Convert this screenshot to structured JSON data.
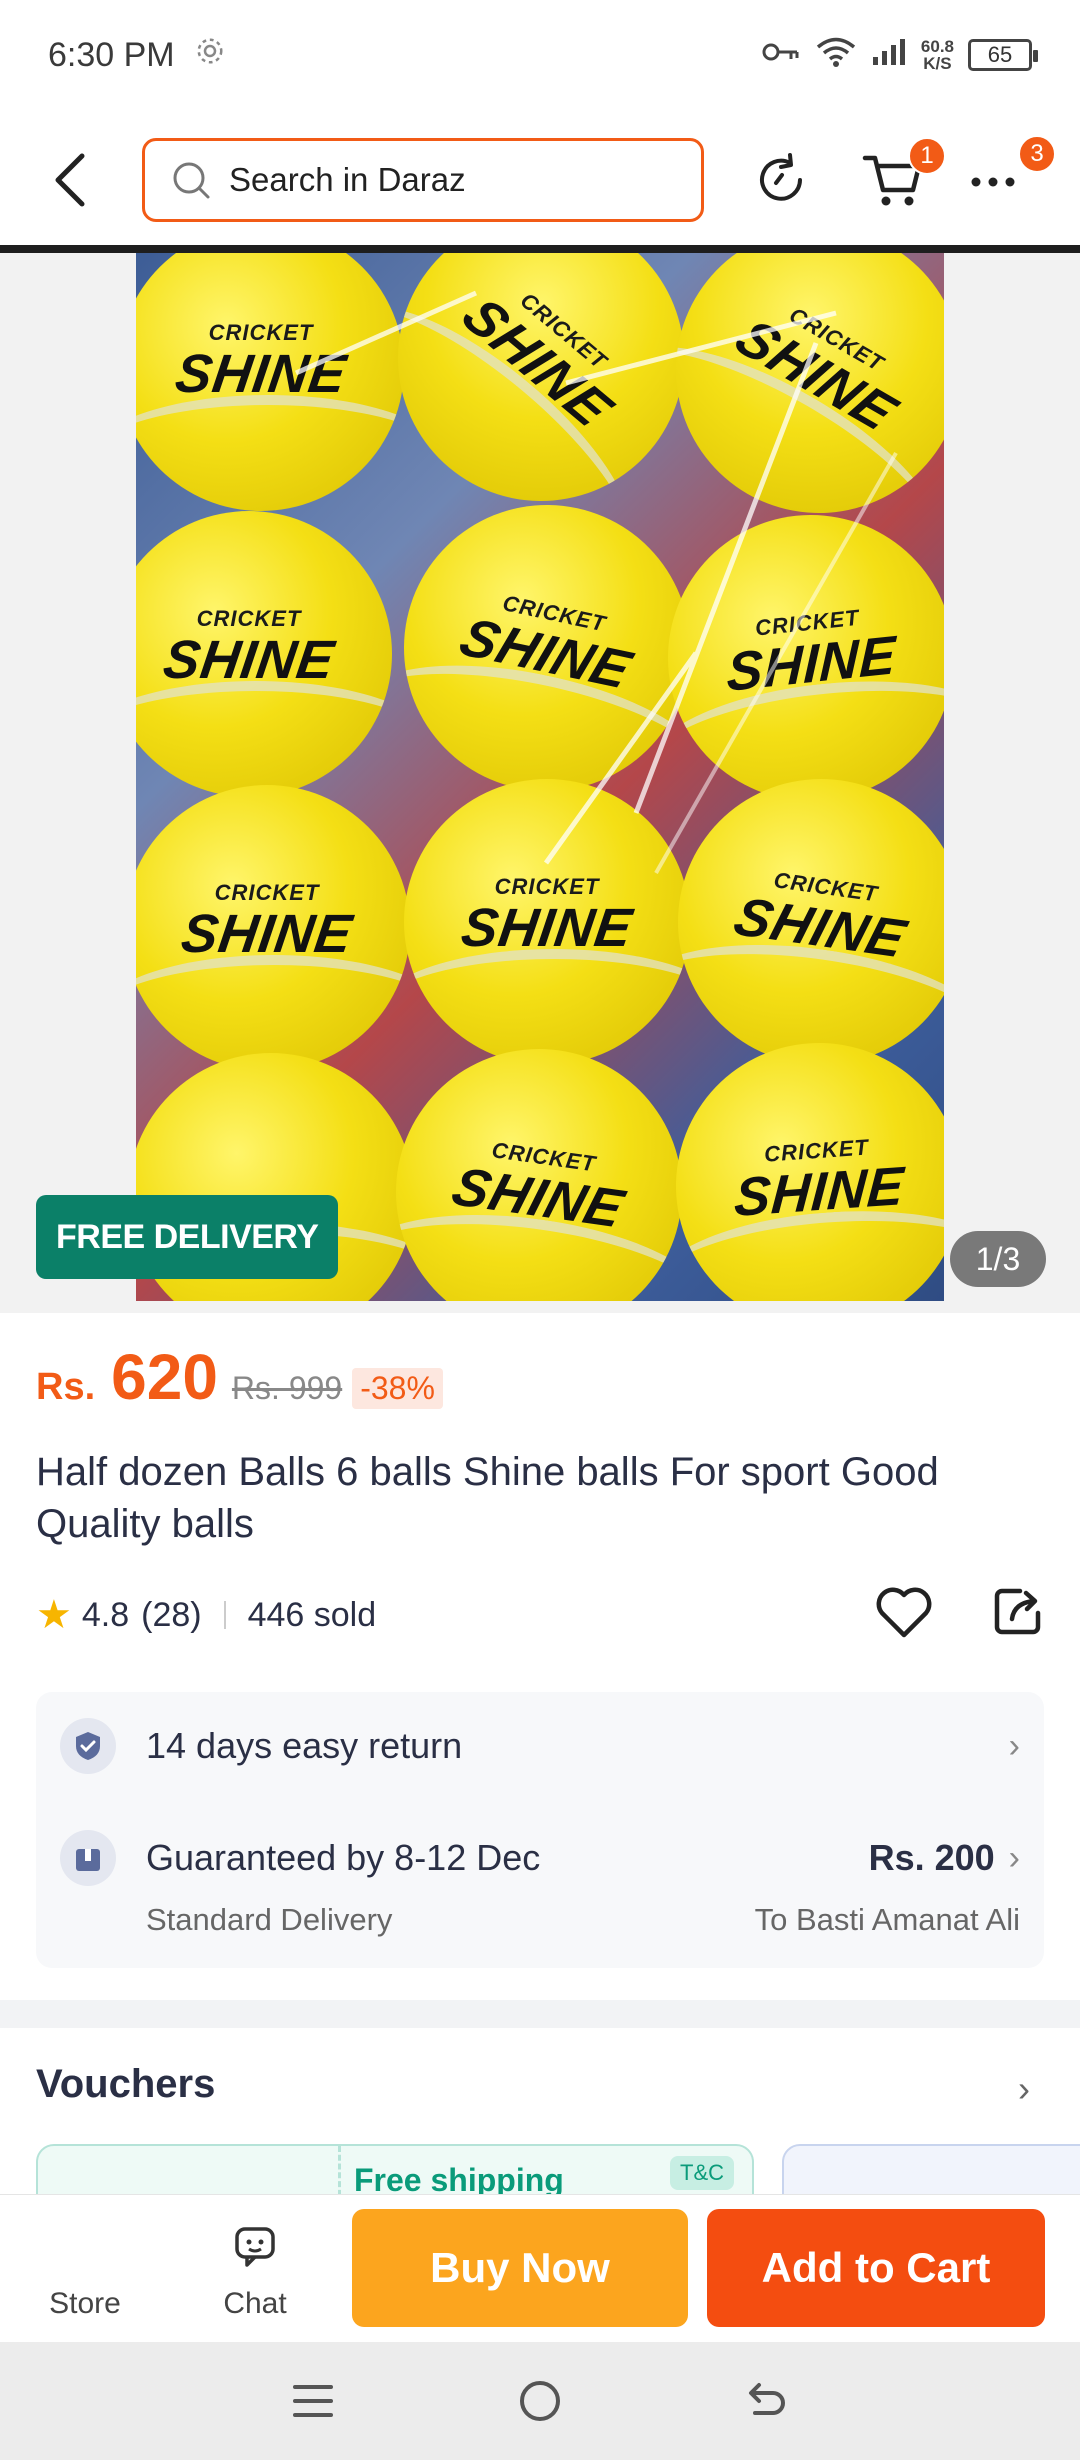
{
  "status_bar": {
    "time": "6:30 PM",
    "net_speed_value": "60.8",
    "net_speed_unit": "K/S",
    "battery": "65",
    "icons": [
      "settings-gear-icon",
      "key-icon",
      "wifi-icon",
      "signal-icon",
      "battery-icon"
    ]
  },
  "nav": {
    "search_placeholder": "Search in Daraz",
    "cart_badge": "1",
    "more_badge": "3",
    "icons": [
      "back-icon",
      "search-icon",
      "refresh-icon",
      "cart-icon",
      "more-icon"
    ]
  },
  "gallery": {
    "free_delivery_label": "FREE DELIVERY",
    "image_counter": "1/3",
    "ball_brand_small": "CRICKET",
    "ball_brand_big": "SHINE"
  },
  "product": {
    "currency": "Rs.",
    "price": "620",
    "original_price": "Rs. 999",
    "discount": "-38%",
    "title": "Half dozen Balls 6 balls Shine balls For sport Good Quality balls",
    "rating": "4.8",
    "rating_count": "(28)",
    "sold": "446 sold"
  },
  "info": {
    "return_text": "14 days easy return",
    "delivery_guarantee": "Guaranteed by 8-12 Dec",
    "delivery_type": "Standard Delivery",
    "delivery_fee": "Rs. 200",
    "delivery_to": "To Basti Amanat Ali"
  },
  "vouchers": {
    "title": "Vouchers",
    "card_title": "Free shipping",
    "card_tag": "T&C"
  },
  "action_bar": {
    "store_label": "Store",
    "chat_label": "Chat",
    "buy_now_label": "Buy Now",
    "add_to_cart_label": "Add to Cart"
  },
  "colors": {
    "brand_orange": "#f25b16",
    "buy_now": "#fca51e",
    "add_to_cart": "#f44d10",
    "free_delivery": "#0b8068"
  }
}
